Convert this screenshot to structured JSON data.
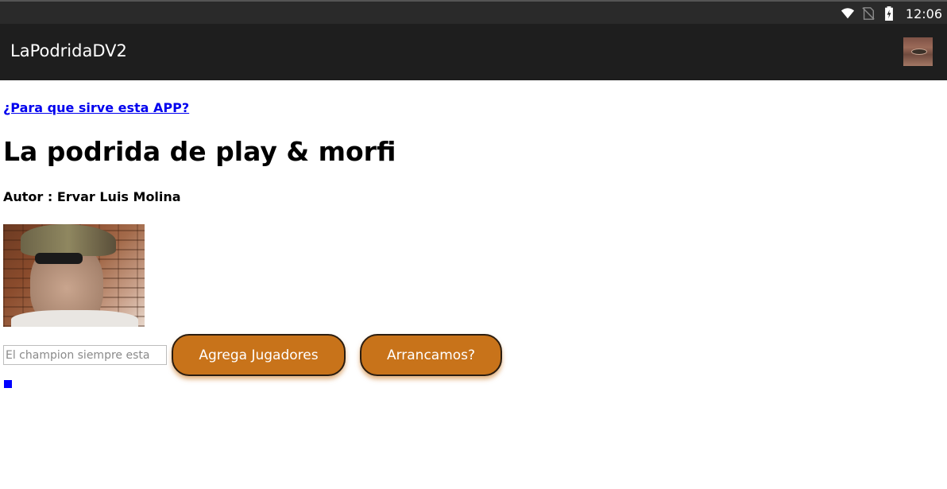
{
  "status_bar": {
    "time": "12:06",
    "icons": [
      "wifi-icon",
      "no-sim-icon",
      "battery-charging-icon"
    ]
  },
  "app_bar": {
    "title": "LaPodridaDV2",
    "avatar_icon": "user-avatar-image"
  },
  "main": {
    "info_link": "¿Para que sirve esta APP?",
    "title": "La podrida de play & morfi",
    "author": "Autor : Ervar Luis Molina",
    "photo_icon": "author-photo",
    "champion_input": {
      "value": "",
      "placeholder": "El champion siempre esta"
    },
    "add_players_label": "Agrega Jugadores",
    "start_label": "Arrancamos?"
  },
  "colors": {
    "accent_button": "#c8731a",
    "link": "#0000ee",
    "app_bar": "#1e1e1e",
    "status_bar": "#2a2a2a",
    "indicator": "#0000ff"
  }
}
